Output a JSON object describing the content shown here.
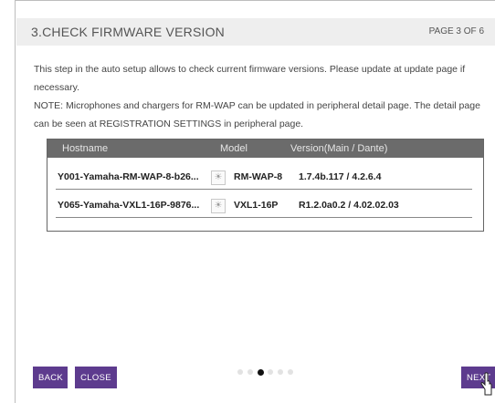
{
  "header": {
    "title": "3.CHECK FIRMWARE VERSION",
    "page": "PAGE 3 OF 6"
  },
  "description": {
    "line1": "This step in the auto setup allows to check current firmware versions. Please update at update page if",
    "line2": "necessary.",
    "line3": "NOTE: Microphones and chargers for RM-WAP can be updated in peripheral detail page. The detail page",
    "line4": "can be seen at REGISTRATION SETTINGS in peripheral page."
  },
  "table": {
    "columns": [
      "Hostname",
      "Model",
      "Version(Main / Dante)"
    ],
    "rows": [
      {
        "hostname": "Y001-Yamaha-RM-WAP-8-b26...",
        "model": "RM-WAP-8",
        "version": "1.7.4b.117 / 4.2.6.4"
      },
      {
        "hostname": "Y065-Yamaha-VXL1-16P-9876...",
        "model": "VXL1-16P",
        "version": "R1.2.0a0.2 / 4.02.02.03"
      }
    ]
  },
  "buttons": {
    "back": "BACK",
    "close": "CLOSE",
    "next": "NEXT"
  },
  "pager": {
    "total": 6,
    "current": 3
  },
  "colors": {
    "button": "#5d3b8e",
    "table_header": "#6b6b6b",
    "header_bg": "#eeeeee"
  },
  "icons": {
    "model": "device-sun-icon"
  }
}
